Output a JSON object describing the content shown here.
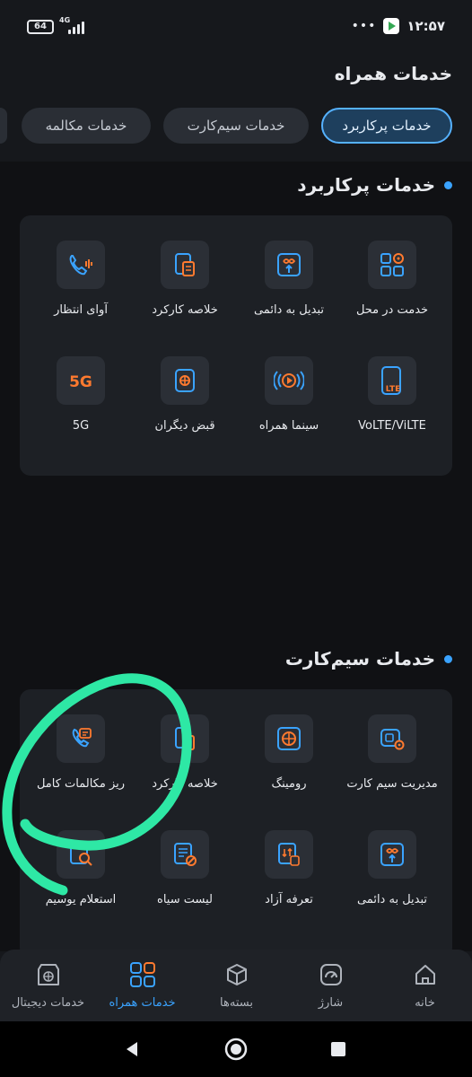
{
  "status_bar": {
    "battery": "64",
    "network": "4G",
    "time": "۱۲:۵۷",
    "overflow": "•••"
  },
  "header": {
    "title": "خدمات همراه"
  },
  "tabs": [
    {
      "label": "خدمات پرکاربرد",
      "active": true
    },
    {
      "label": "خدمات سیم‌کارت",
      "active": false
    },
    {
      "label": "خدمات مکالمه",
      "active": false
    }
  ],
  "sections": [
    {
      "title": "خدمات پرکاربرد",
      "items": [
        {
          "label": "خدمت در محل",
          "icon": "grid-location-icon"
        },
        {
          "label": "تبدیل به دائمی",
          "icon": "convert-permanent-icon"
        },
        {
          "label": "خلاصه کارکرد",
          "icon": "usage-summary-icon"
        },
        {
          "label": "آوای انتظار",
          "icon": "phone-ringback-icon"
        },
        {
          "label": "VoLTE/ViLTE",
          "icon": "lte-icon"
        },
        {
          "label": "سینما همراه",
          "icon": "cinema-play-icon"
        },
        {
          "label": "قبض دیگران",
          "icon": "others-bill-icon"
        },
        {
          "label": "5G",
          "icon": "5g-icon"
        }
      ]
    },
    {
      "title": "خدمات سیم‌کارت",
      "items": [
        {
          "label": "مدیریت سیم کارت",
          "icon": "sim-manage-icon"
        },
        {
          "label": "رومینگ",
          "icon": "roaming-globe-icon"
        },
        {
          "label": "خلاصه کارکرد",
          "icon": "usage-summary-icon"
        },
        {
          "label": "ریز مکالمات کامل",
          "icon": "call-details-icon"
        },
        {
          "label": "تبدیل به دائمی",
          "icon": "convert-permanent-icon"
        },
        {
          "label": "تعرفه آزاد",
          "icon": "free-tariff-icon"
        },
        {
          "label": "لیست سیاه",
          "icon": "blacklist-icon"
        },
        {
          "label": "استعلام یوسیم",
          "icon": "usim-inquiry-icon"
        }
      ]
    }
  ],
  "bottom_nav": [
    {
      "label": "خانه",
      "icon": "home-icon",
      "active": false
    },
    {
      "label": "شارژ",
      "icon": "charge-gauge-icon",
      "active": false
    },
    {
      "label": "بسته‌ها",
      "icon": "package-box-icon",
      "active": false
    },
    {
      "label": "خدمات همراه",
      "icon": "services-grid-icon",
      "active": true
    },
    {
      "label": "خدمات دیجیتال",
      "icon": "digital-store-icon",
      "active": false
    }
  ],
  "colors": {
    "accent": "#3aa3ff",
    "icon_orange": "#ff7a2f",
    "icon_blue": "#3aa3ff",
    "highlight_marker": "#2ee8a5"
  }
}
